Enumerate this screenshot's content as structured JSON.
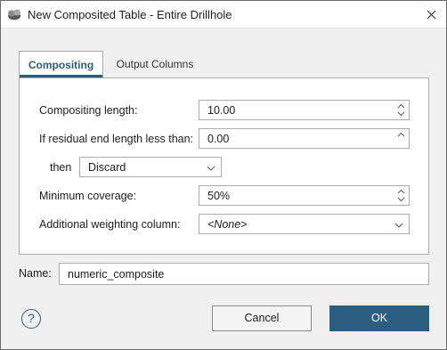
{
  "window": {
    "title": "New Composited Table - Entire Drillhole"
  },
  "tabs": [
    {
      "label": "Compositing",
      "active": true
    },
    {
      "label": "Output Columns",
      "active": false
    }
  ],
  "form": {
    "compositing_length": {
      "label": "Compositing length:",
      "value": "10.00"
    },
    "residual": {
      "label": "If residual end length less than:",
      "value": "0.00"
    },
    "then": {
      "label": "then",
      "value": "Discard"
    },
    "min_coverage": {
      "label": "Minimum coverage:",
      "value": "50%"
    },
    "weighting": {
      "label": "Additional weighting column:",
      "value": "<None>"
    }
  },
  "name": {
    "label": "Name:",
    "value": "numeric_composite"
  },
  "buttons": {
    "help": "?",
    "cancel": "Cancel",
    "ok": "OK"
  },
  "colors": {
    "accent": "#2b5d80",
    "border": "#adadad",
    "background": "#f0f0f0"
  },
  "icons": {
    "app": "drillhole-app-icon",
    "close": "close-icon",
    "spin": "spinner-arrows-icon",
    "dropdown": "chevron-down-icon",
    "help": "help-icon"
  }
}
